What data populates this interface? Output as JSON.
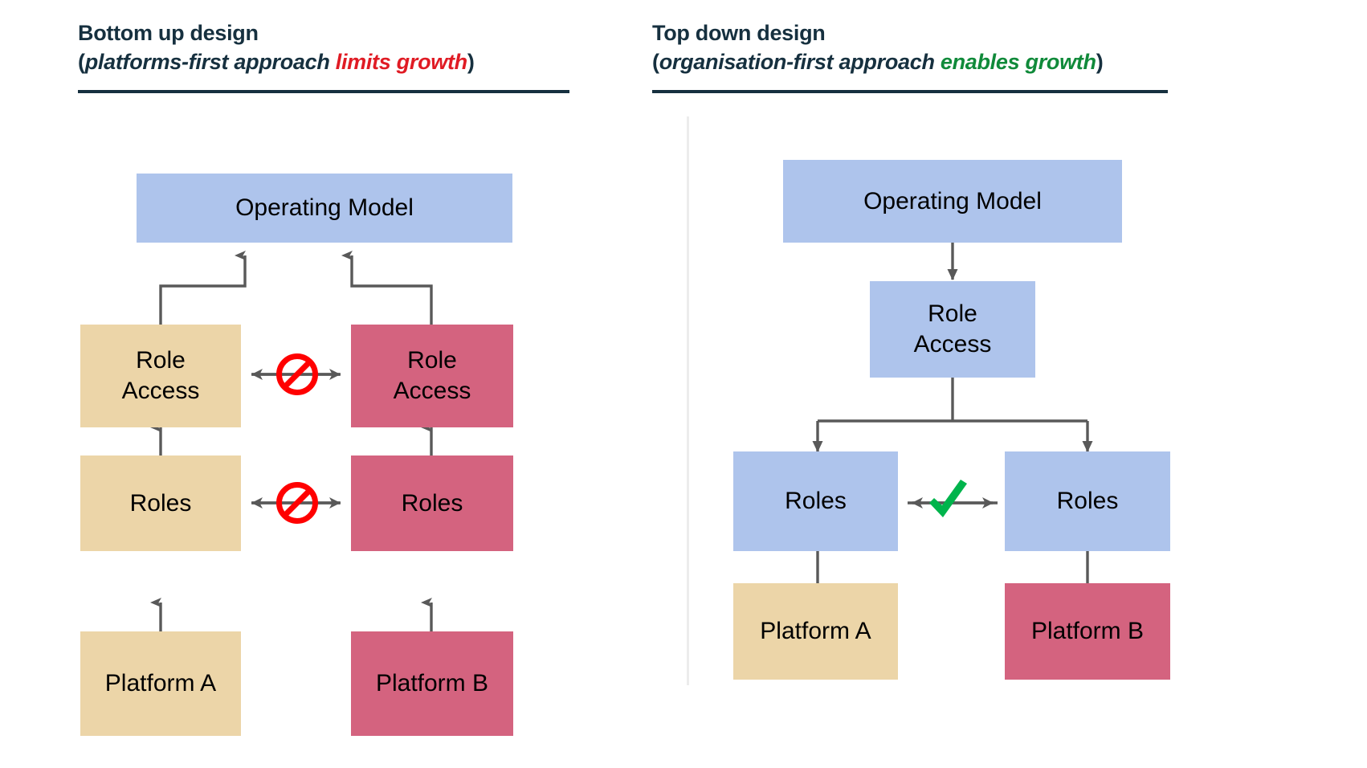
{
  "panels": [
    {
      "id": "bottom-up",
      "title_line1": "Bottom up design",
      "paren_open": "(",
      "subtitle_plain": "platforms-first approach ",
      "subtitle_accent": "limits growth",
      "paren_close": ")",
      "accent_color": "#e01b24",
      "nodes": {
        "operating_model": "Operating Model",
        "role_access_left": "Role\nAccess",
        "role_access_right": "Role\nAccess",
        "roles_left": "Roles",
        "roles_right": "Roles",
        "platform_a": "Platform A",
        "platform_b": "Platform B"
      },
      "link_badges": [
        "prohibited-icon",
        "prohibited-icon"
      ]
    },
    {
      "id": "top-down",
      "title_line1": "Top down design",
      "paren_open": "(",
      "subtitle_plain": "organisation-first approach ",
      "subtitle_accent": "enables growth",
      "paren_close": ")",
      "accent_color": "#108a3a",
      "nodes": {
        "operating_model": "Operating Model",
        "role_access": "Role\nAccess",
        "roles_left": "Roles",
        "roles_right": "Roles",
        "platform_a": "Platform A",
        "platform_b": "Platform B"
      },
      "link_badges": [
        "check-icon"
      ]
    }
  ],
  "colors": {
    "heading": "#16303f",
    "rule": "#16303f",
    "divider": "#ececec",
    "box_blue": "#aec4ec",
    "box_sand": "#ecd5a8",
    "box_rose": "#d4637f",
    "connector": "#595959",
    "prohibited": "#ff0000",
    "check": "#00b44c",
    "limits_growth": "#e01b24",
    "enables_growth": "#108a3a"
  },
  "icons": {
    "prohibited": "prohibited-icon",
    "check": "check-icon"
  }
}
